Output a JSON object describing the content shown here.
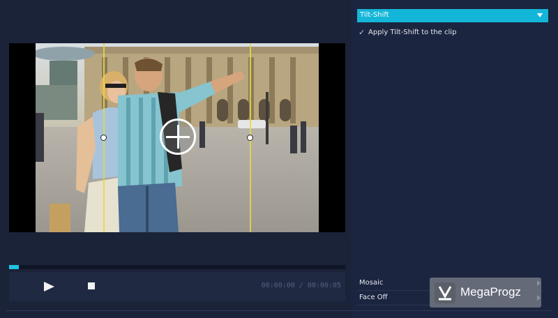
{
  "panel": {
    "effect_dropdown": {
      "selected": "Tilt-Shift"
    },
    "apply_checkbox": {
      "label": "Apply Tilt-Shift to the clip",
      "checked": true
    }
  },
  "player": {
    "timecode": "00:00:00 / 00:00:05",
    "progress_fraction": 0.03
  },
  "effects_list": [
    {
      "label": "Mosaic"
    },
    {
      "label": "Face Off"
    }
  ],
  "watermark": {
    "text": "MegaProgz"
  },
  "icons": {
    "play": "play-icon",
    "stop": "stop-icon",
    "check": "check-icon",
    "dropdown": "chevron-down-icon",
    "expand": "chevron-right-icon",
    "center": "move-handle-icon"
  },
  "colors": {
    "accent": "#13b6d8",
    "guide": "#e8d840",
    "background": "#1a2238"
  }
}
